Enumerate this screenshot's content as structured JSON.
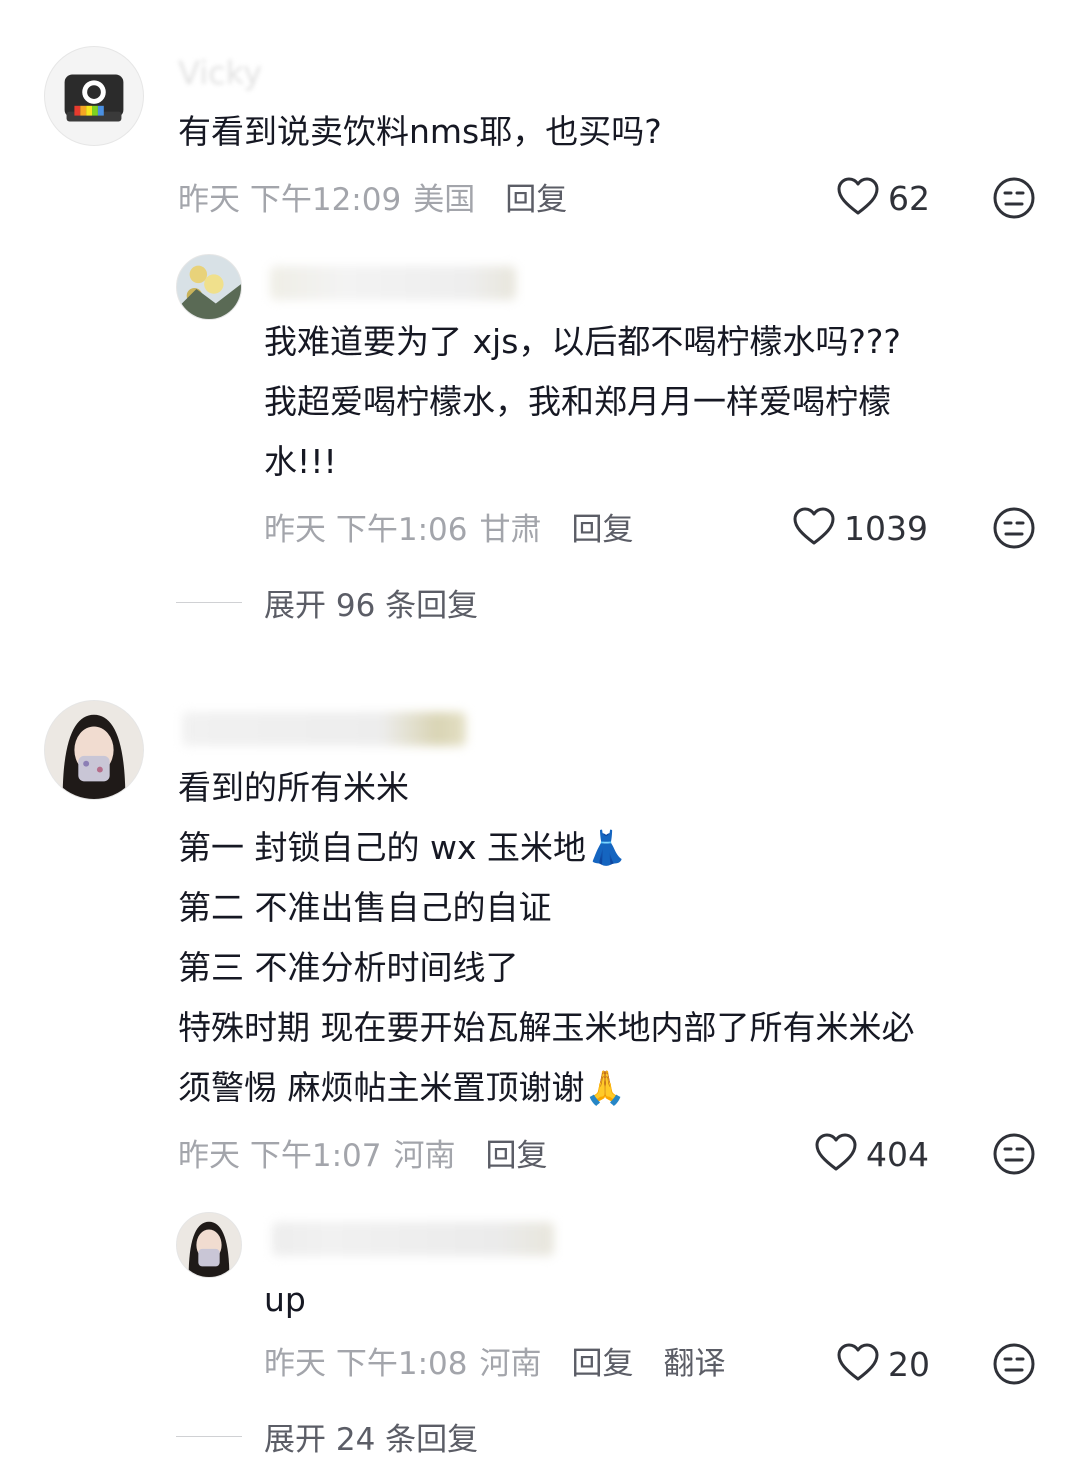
{
  "comments": [
    {
      "username": "Vicky",
      "text": "有看到说卖饮料nms耶，也买吗?",
      "time": "昨天 下午12:09",
      "location": "美国",
      "reply_label": "回复",
      "likes": "62"
    },
    {
      "username": "",
      "text": "我难道要为了 xjs，以后都不喝柠檬水吗???\n我超爱喝柠檬水，我和郑月月一样爱喝柠檬\n水!!!",
      "time": "昨天 下午1:06",
      "location": "甘肃",
      "reply_label": "回复",
      "likes": "1039",
      "expand_label": "展开 96 条回复"
    },
    {
      "username": "",
      "text": "看到的所有米米\n第一 封锁自己的 wx 玉米地👗\n第二 不准出售自己的自证\n第三 不准分析时间线了\n特殊时期 现在要开始瓦解玉米地内部了所有米米必\n须警惕 麻烦帖主米置顶谢谢🙏",
      "time": "昨天 下午1:07",
      "location": "河南",
      "reply_label": "回复",
      "likes": "404"
    },
    {
      "username": "",
      "text": "up",
      "time": "昨天 下午1:08",
      "location": "河南",
      "reply_label": "回复",
      "translate_label": "翻译",
      "likes": "20",
      "expand_label": "展开 24 条回复"
    }
  ],
  "icons": {
    "like": "heart-outline-icon",
    "emoji": "neutral-face-icon"
  },
  "colors": {
    "text_primary": "#161823",
    "text_meta": "#a3a5ab",
    "text_action": "#5b5d66"
  }
}
